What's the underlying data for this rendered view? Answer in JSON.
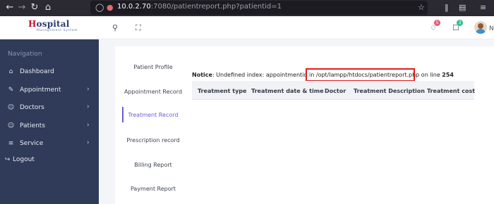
{
  "browser": {
    "back_icon": "back-arrow-icon",
    "forward_icon": "forward-arrow-icon",
    "reload_icon": "reload-icon",
    "home_icon": "home-icon",
    "url_host": "10.0.2.70",
    "url_rest": ":7080/patientreport.php?patientid=1"
  },
  "header": {
    "logo_initial": "H",
    "logo_rest": "ospital",
    "logo_tagline": "Management System",
    "notification_count": "5",
    "message_count": "3",
    "user_initial": "N",
    "accent_notification": "#e55a78",
    "accent_message": "#2ec08a"
  },
  "sidebar": {
    "heading": "Navigation",
    "items": [
      {
        "label": "Dashboard",
        "icon": "home-icon",
        "has_submenu": false
      },
      {
        "label": "Appointment",
        "icon": "edit-icon",
        "has_submenu": true
      },
      {
        "label": "Doctors",
        "icon": "user-icon",
        "has_submenu": true
      },
      {
        "label": "Patients",
        "icon": "user-icon",
        "has_submenu": true
      },
      {
        "label": "Service",
        "icon": "list-icon",
        "has_submenu": true
      },
      {
        "label": "Logout",
        "icon": "logout-icon",
        "has_submenu": false
      }
    ]
  },
  "tabs": [
    {
      "label": "Patient Profile",
      "active": false
    },
    {
      "label": "Appointment Record",
      "active": false
    },
    {
      "label": "Treatment Record",
      "active": true
    },
    {
      "label": "Prescription record",
      "active": false
    },
    {
      "label": "Billing Report",
      "active": false
    },
    {
      "label": "Payment Report",
      "active": false
    }
  ],
  "notice": {
    "label": "Notice",
    "before_path": ": Undefined index: appointmentid in ",
    "path": "/opt/lampp/htdocs/patientreport.php",
    "after_path": " on line ",
    "line": "254",
    "highlight_color": "#e41b1b"
  },
  "table": {
    "columns": [
      "Treatment type",
      "Treatment date & time",
      "Doctor",
      "Treatment Description",
      "Treatment cost"
    ]
  }
}
